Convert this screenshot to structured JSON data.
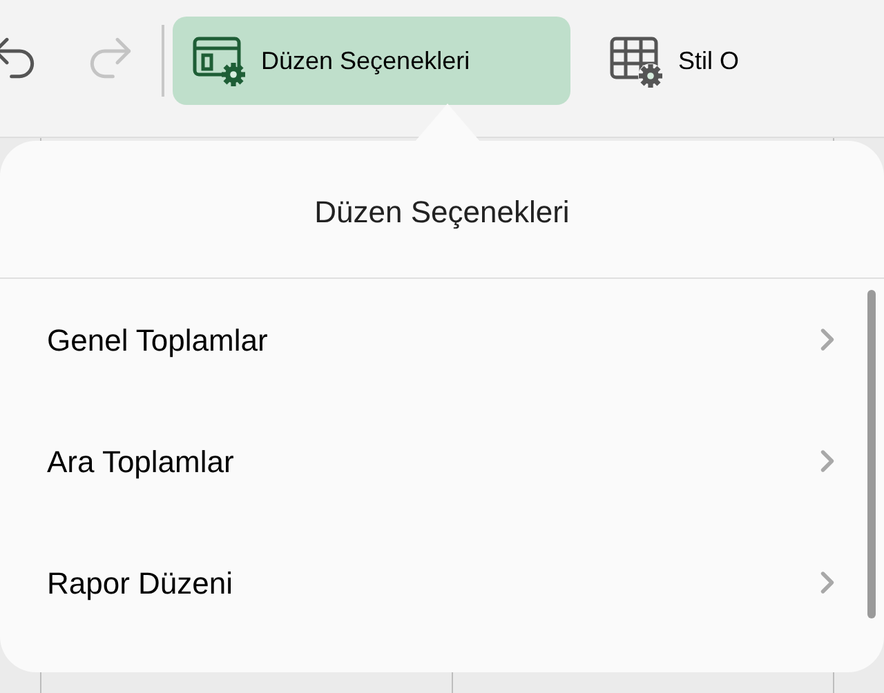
{
  "toolbar": {
    "buttons": [
      {
        "kind": "undo",
        "disabled": false
      },
      {
        "kind": "redo",
        "disabled": true
      },
      {
        "kind": "layout",
        "label": "Düzen Seçenekleri",
        "selected": true
      },
      {
        "kind": "style",
        "label": "Stil O",
        "selected": false
      }
    ]
  },
  "popover": {
    "title": "Düzen Seçenekleri",
    "items": [
      {
        "label": "Genel Toplamlar"
      },
      {
        "label": "Ara Toplamlar"
      },
      {
        "label": "Rapor Düzeni"
      }
    ]
  }
}
